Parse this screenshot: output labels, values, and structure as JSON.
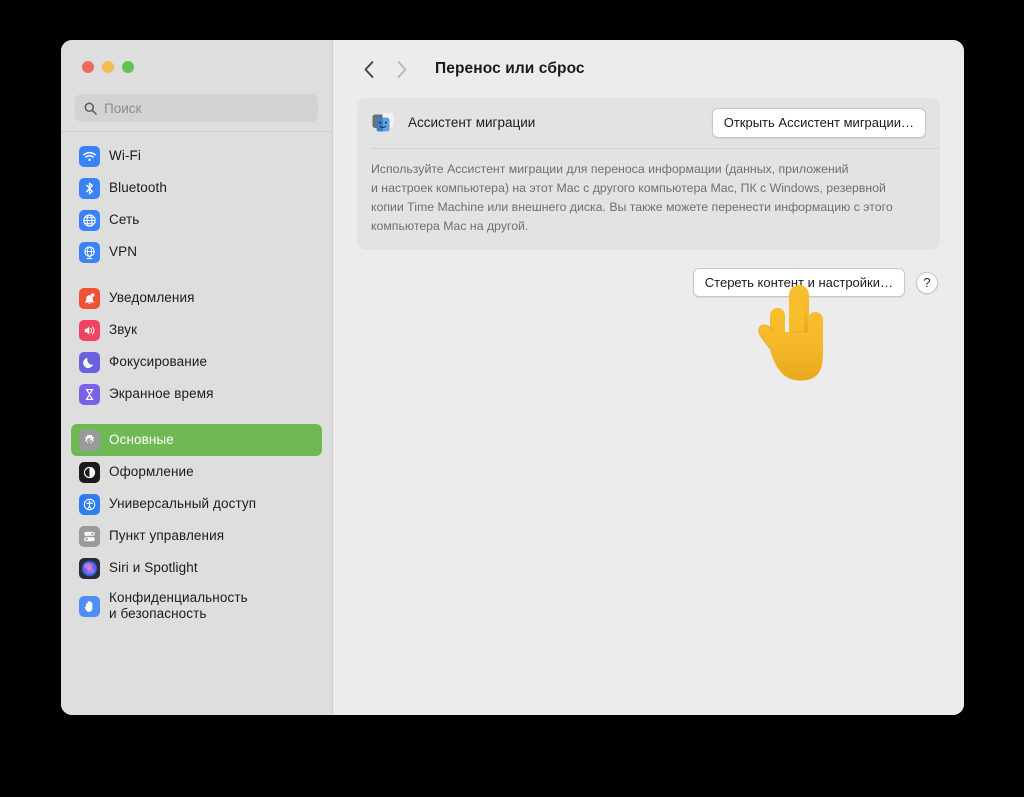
{
  "window": {
    "traffic_lights": [
      {
        "name": "close",
        "color": "#ec6a5e"
      },
      {
        "name": "minimize",
        "color": "#f4bd4f"
      },
      {
        "name": "maximize",
        "color": "#61c454"
      }
    ]
  },
  "search": {
    "placeholder": "Поиск",
    "value": ""
  },
  "sidebar": {
    "groups": [
      {
        "items": [
          {
            "label": "Wi-Fi",
            "icon": "wifi-icon",
            "color": "#3b82f6",
            "selected": false
          },
          {
            "label": "Bluetooth",
            "icon": "bluetooth-icon",
            "color": "#3b82f6",
            "selected": false
          },
          {
            "label": "Сеть",
            "icon": "globe-icon",
            "color": "#3b82f6",
            "selected": false
          },
          {
            "label": "VPN",
            "icon": "vpn-globe-icon",
            "color": "#3b82f6",
            "selected": false
          }
        ]
      },
      {
        "items": [
          {
            "label": "Уведомления",
            "icon": "bell-icon",
            "color": "#f05138",
            "selected": false
          },
          {
            "label": "Звук",
            "icon": "speaker-icon",
            "color": "#ee4361",
            "selected": false
          },
          {
            "label": "Фокусирование",
            "icon": "moon-icon",
            "color": "#6b60de",
            "selected": false
          },
          {
            "label": "Экранное время",
            "icon": "hourglass-icon",
            "color": "#7b61e8",
            "selected": false
          }
        ]
      },
      {
        "items": [
          {
            "label": "Основные",
            "icon": "gear-icon",
            "color": "#9a9a9a",
            "selected": true
          },
          {
            "label": "Оформление",
            "icon": "appearance-icon",
            "color": "#1b1b1b",
            "selected": false
          },
          {
            "label": "Универсальный доступ",
            "icon": "accessibility-icon",
            "color": "#2f7ef0",
            "selected": false
          },
          {
            "label": "Пункт управления",
            "icon": "control-center-icon",
            "color": "#9a9a9a",
            "selected": false
          },
          {
            "label": "Siri и Spotlight",
            "icon": "siri-icon",
            "color": "#2b2b38",
            "selected": false
          },
          {
            "label": "Конфиденциальность\nи безопасность",
            "icon": "hand-icon",
            "color": "#4f8ef7",
            "selected": false,
            "two_line": true
          }
        ]
      }
    ],
    "selection_color": "#6fb955"
  },
  "toolbar": {
    "back_icon": "chevron-left-icon",
    "forward_icon": "chevron-right-icon",
    "back_enabled": true,
    "forward_enabled": false,
    "title": "Перенос или сброс"
  },
  "main": {
    "migration_card": {
      "icon": "migration-assistant-icon",
      "label": "Ассистент миграции",
      "button_label": "Открыть Ассистент миграции…",
      "description": "Используйте Ассистент миграции для переноса информации (данных, приложений\nи настроек компьютера) на этот Mac с другого компьютера Mac, ПК с Windows, резервной\nкопии Time Machine или внешнего диска. Вы также можете перенести информацию с этого\nкомпьютера Mac на другой."
    },
    "erase_button_label": "Стереть контент и настройки…",
    "help_button_label": "?"
  },
  "cursor": {
    "icon": "pointing-up-hand-cursor"
  }
}
